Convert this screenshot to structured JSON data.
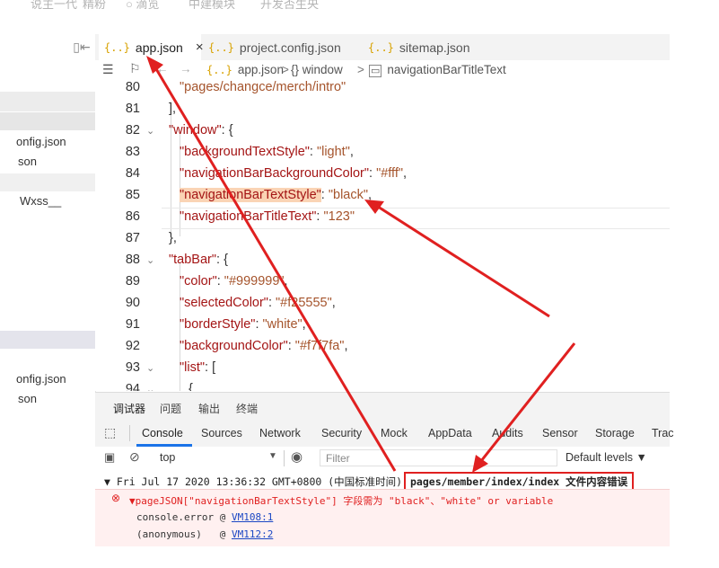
{
  "top_strip": {
    "texts": [
      "说主一代",
      "精粉",
      "○ 滴览",
      "中建模块",
      "开发否生央"
    ]
  },
  "sidebar": {
    "items": [
      "onfig.json",
      "son",
      "Wxss__",
      "onfig.json",
      "son"
    ]
  },
  "editor": {
    "tabs": [
      {
        "label": "app.json",
        "active": true,
        "close": "×"
      },
      {
        "label": "project.config.json",
        "active": false
      },
      {
        "label": "sitemap.json",
        "active": false
      }
    ],
    "breadcrumb": {
      "file": "app.json",
      "seg1": "{} window",
      "seg2": "navigationBarTitleText",
      "sep": ">"
    },
    "line_numbers": [
      "80",
      "81",
      "82",
      "83",
      "84",
      "85",
      "86",
      "87",
      "88",
      "89",
      "90",
      "91",
      "92",
      "93",
      "94"
    ],
    "lines": {
      "l80": "\"pages/changce/merch/intro\"",
      "l81": "],",
      "l82_key": "\"window\"",
      "l82_rest": ": {",
      "l83_key": "\"backgroundTextStyle\"",
      "l83_val": "\"light\"",
      "l84_key": "\"navigationBarBackgroundColor\"",
      "l84_val": "\"#fff\"",
      "l85_key": "\"navigationBarTextStyle\"",
      "l85_val": "\"black\"",
      "l86_key": "\"navigationBarTitleText\"",
      "l86_val": "\"123\"",
      "l87": "},",
      "l88_key": "\"tabBar\"",
      "l88_rest": ": {",
      "l89_key": "\"color\"",
      "l89_val": "\"#999999\"",
      "l90_key": "\"selectedColor\"",
      "l90_val": "\"#f25555\"",
      "l91_key": "\"borderStyle\"",
      "l91_val": "\"white\"",
      "l92_key": "\"backgroundColor\"",
      "l92_val": "\"#f7f7fa\"",
      "l93_key": "\"list\"",
      "l93_rest": ": [",
      "l94": "{"
    }
  },
  "panel": {
    "tabs": [
      "调试器",
      "问题",
      "输出",
      "终端"
    ],
    "devtools_tabs": [
      "Console",
      "Sources",
      "Network",
      "Security",
      "Mock",
      "AppData",
      "Audits",
      "Sensor",
      "Storage",
      "Trac"
    ],
    "context": "top",
    "filter_placeholder": "Filter",
    "levels": "Default levels ▼"
  },
  "console": {
    "group_header": "▼ Fri Jul 17 2020 13:36:32 GMT+0800 (中国标准时间)",
    "group_path": "pages/member/index/index 文件内容错误",
    "error_prefix": "▼pageJSON[\"navigationBarTextStyle\"] 字段需为 \"black\"、\"white\" or variable",
    "stack1_fn": "console.error @ ",
    "stack1_link": "VM108:1",
    "stack2_fn": "(anonymous)   @ ",
    "stack2_link": "VM112:2"
  },
  "colors": {
    "annotation_red": "#e02020",
    "error_bg": "#fff0f0",
    "error_text": "#e02020",
    "highlight": "#fad4b5"
  }
}
